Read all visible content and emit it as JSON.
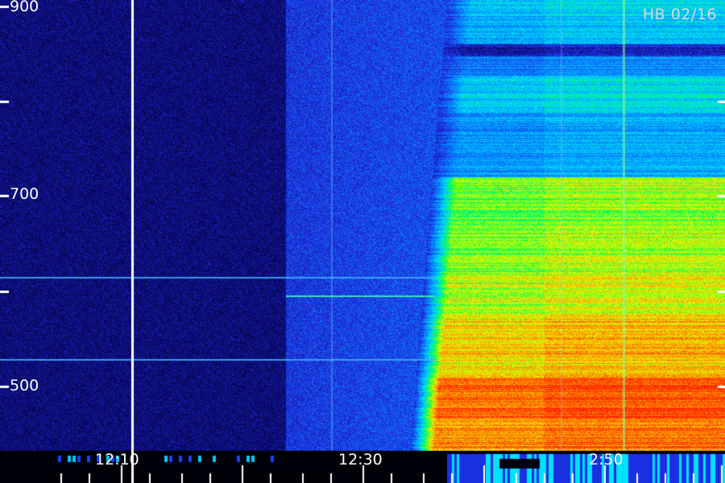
{
  "chart_data": {
    "type": "heatmap",
    "title": "",
    "annotation": "HB 02/16",
    "xlabel": "",
    "ylabel": "",
    "x_tick_labels": [
      "12:10",
      "12:30",
      "2:50"
    ],
    "y_tick_labels": [
      "900",
      "700",
      "500"
    ],
    "y_major_ticks": [
      900,
      800,
      700,
      600,
      500
    ],
    "ylim": [
      420,
      900
    ],
    "colormap": [
      "#000018",
      "#1010a0",
      "#2a3cff",
      "#00d8ff",
      "#00ff40",
      "#ffff00",
      "#ff8000",
      "#ff2000"
    ],
    "intensity_bands": [
      {
        "freq_from": 420,
        "freq_to": 900,
        "time_segment": "before 12:30",
        "level": "very low"
      },
      {
        "freq_from": 420,
        "freq_to": 900,
        "time_segment": "12:30 onward",
        "level": "low"
      },
      {
        "freq_from": 800,
        "freq_to": 900,
        "time_segment": "after onset",
        "level": "medium (cyan)"
      },
      {
        "freq_from": 650,
        "freq_to": 730,
        "time_segment": "after onset",
        "level": "high (green)"
      },
      {
        "freq_from": 560,
        "freq_to": 620,
        "time_segment": "after onset",
        "level": "higher (yellow)"
      },
      {
        "freq_from": 430,
        "freq_to": 520,
        "time_segment": "after onset",
        "level": "highest (orange/red)"
      }
    ],
    "narrowband_lines": [
      598,
      586,
      519
    ],
    "vertical_marker": "white line left of 12:10"
  }
}
